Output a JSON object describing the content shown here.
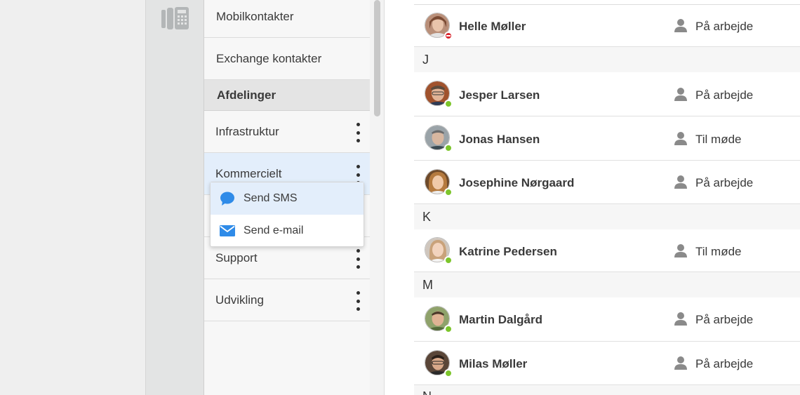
{
  "nav": {
    "top_items": [
      {
        "label": "Mobilkontakter"
      },
      {
        "label": "Exchange kontakter"
      }
    ],
    "section_header": "Afdelinger",
    "departments": [
      {
        "label": "Infrastruktur"
      },
      {
        "label": "Kommercielt"
      },
      {
        "label": "Support"
      },
      {
        "label": "Udvikling"
      }
    ]
  },
  "popup": {
    "items": [
      {
        "label": "Send SMS",
        "icon": "chat-bubble-icon"
      },
      {
        "label": "Send e-mail",
        "icon": "envelope-icon"
      }
    ]
  },
  "colors": {
    "accent": "#2f8be8",
    "status_available": "#7cc52b",
    "status_busy": "#d9262e"
  },
  "contacts": {
    "letters": [
      "J",
      "K",
      "M",
      "N"
    ],
    "rows": [
      {
        "name": "Helle Møller",
        "status": "På arbejde",
        "presence": "busy"
      },
      {
        "name": "Jesper Larsen",
        "status": "På arbejde",
        "presence": "available"
      },
      {
        "name": "Jonas Hansen",
        "status": "Til møde",
        "presence": "available"
      },
      {
        "name": "Josephine Nørgaard",
        "status": "På arbejde",
        "presence": "available"
      },
      {
        "name": "Katrine Pedersen",
        "status": "Til møde",
        "presence": "available"
      },
      {
        "name": "Martin Dalgård",
        "status": "På arbejde",
        "presence": "available"
      },
      {
        "name": "Milas Møller",
        "status": "På arbejde",
        "presence": "available"
      }
    ]
  }
}
